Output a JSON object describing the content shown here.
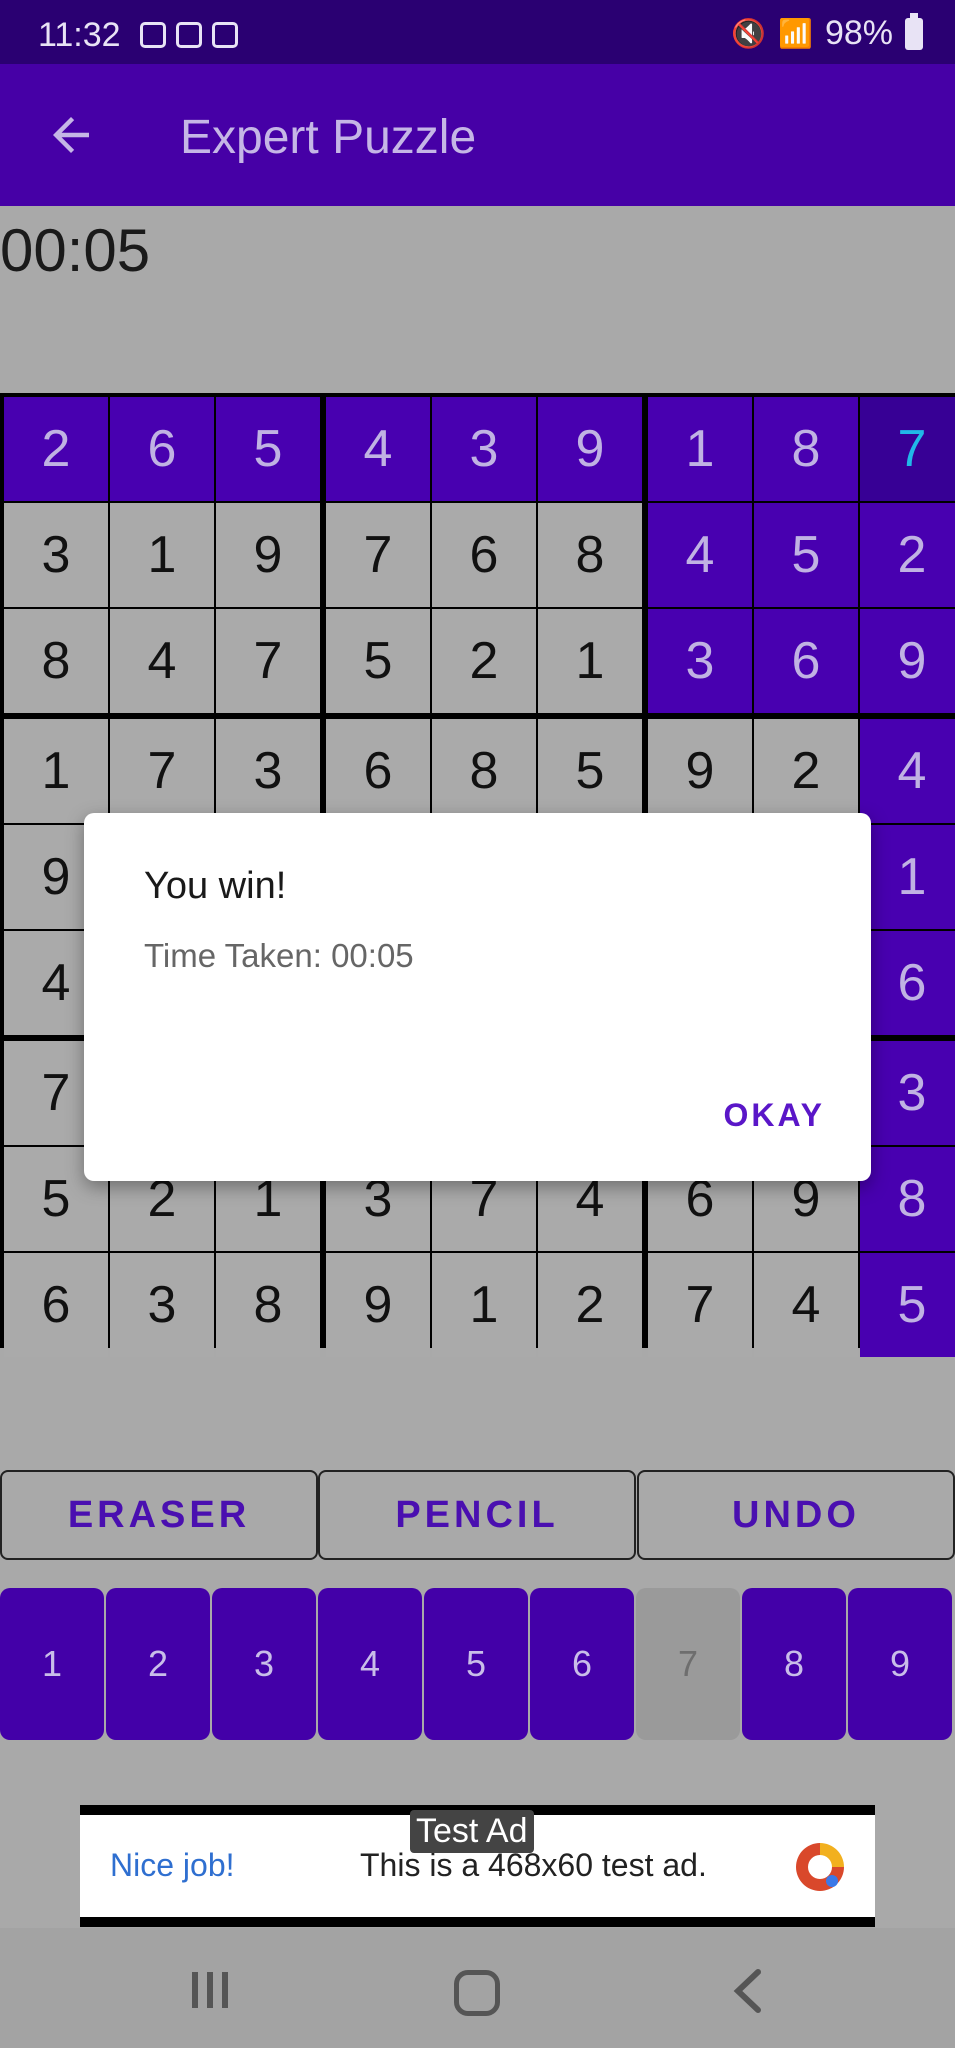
{
  "status_bar": {
    "time": "11:32",
    "battery": "98%"
  },
  "app_bar": {
    "title": "Expert Puzzle"
  },
  "timer": "00:05",
  "board": {
    "cells": [
      [
        "2",
        "6",
        "5",
        "4",
        "3",
        "9",
        "1",
        "8",
        "7"
      ],
      [
        "3",
        "1",
        "9",
        "7",
        "6",
        "8",
        "4",
        "5",
        "2"
      ],
      [
        "8",
        "4",
        "7",
        "5",
        "2",
        "1",
        "3",
        "6",
        "9"
      ],
      [
        "1",
        "7",
        "3",
        "6",
        "8",
        "5",
        "9",
        "2",
        "4"
      ],
      [
        "9",
        "",
        "",
        "",
        "",
        "",
        "",
        "",
        "1"
      ],
      [
        "4",
        "",
        "",
        "",
        "",
        "",
        "",
        "",
        "6"
      ],
      [
        "7",
        "",
        "",
        "",
        "",
        "",
        "",
        "",
        "3"
      ],
      [
        "5",
        "2",
        "1",
        "3",
        "7",
        "4",
        "6",
        "9",
        "8"
      ],
      [
        "6",
        "3",
        "8",
        "9",
        "1",
        "2",
        "7",
        "4",
        "5"
      ]
    ]
  },
  "controls": {
    "eraser": "ERASER",
    "pencil": "PENCIL",
    "undo": "UNDO"
  },
  "numpad": [
    "1",
    "2",
    "3",
    "4",
    "5",
    "6",
    "7",
    "8",
    "9"
  ],
  "ad": {
    "label": "Test Ad",
    "headline": "Nice job!",
    "text": "This is a 468x60 test ad."
  },
  "dialog": {
    "title": "You win!",
    "message": "Time Taken: 00:05",
    "ok_label": "OKAY"
  },
  "colors": {
    "primary": "#4600a6",
    "status_bar": "#2a0072",
    "selected_digit": "#21b8e8",
    "board_bg": "#aaaaaa"
  }
}
